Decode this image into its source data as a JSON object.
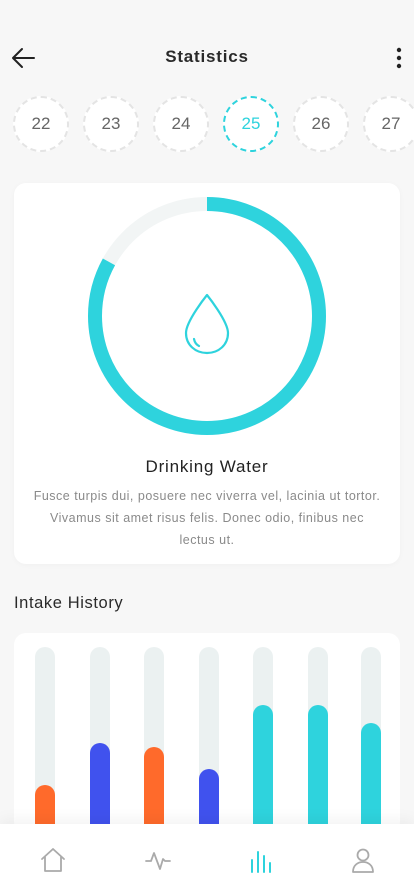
{
  "header": {
    "title": "Statistics",
    "back_icon": "arrow-left-icon",
    "more_icon": "more-vertical-icon"
  },
  "dates": [
    {
      "label": "22",
      "active": false
    },
    {
      "label": "23",
      "active": false
    },
    {
      "label": "24",
      "active": false
    },
    {
      "label": "25",
      "active": true
    },
    {
      "label": "26",
      "active": false
    },
    {
      "label": "27",
      "active": false
    }
  ],
  "water": {
    "title": "Drinking Water",
    "description": "Fusce turpis dui, posuere nec viverra vel, lacinia ut tortor. Vivamus sit amet risus felis. Donec odio, finibus nec lectus ut.",
    "progress": 0.83,
    "icon": "water-drop-icon"
  },
  "history": {
    "title": "Intake History",
    "bars": [
      {
        "level": 0.31,
        "color": "#ff6a2b"
      },
      {
        "level": 0.52,
        "color": "#4052ee"
      },
      {
        "level": 0.5,
        "color": "#ff6a2b"
      },
      {
        "level": 0.39,
        "color": "#4052ee"
      },
      {
        "level": 0.71,
        "color": "#2ed3dd"
      },
      {
        "level": 0.71,
        "color": "#2ed3dd"
      },
      {
        "level": 0.62,
        "color": "#2ed3dd"
      }
    ]
  },
  "colors": {
    "accent": "#2ed3dd",
    "orange": "#ff6a2b",
    "blue": "#4052ee",
    "track": "#ebf1f1"
  },
  "tabbar": [
    {
      "icon": "home-icon",
      "active": false
    },
    {
      "icon": "activity-icon",
      "active": false
    },
    {
      "icon": "bar-chart-icon",
      "active": true
    },
    {
      "icon": "user-icon",
      "active": false
    }
  ]
}
